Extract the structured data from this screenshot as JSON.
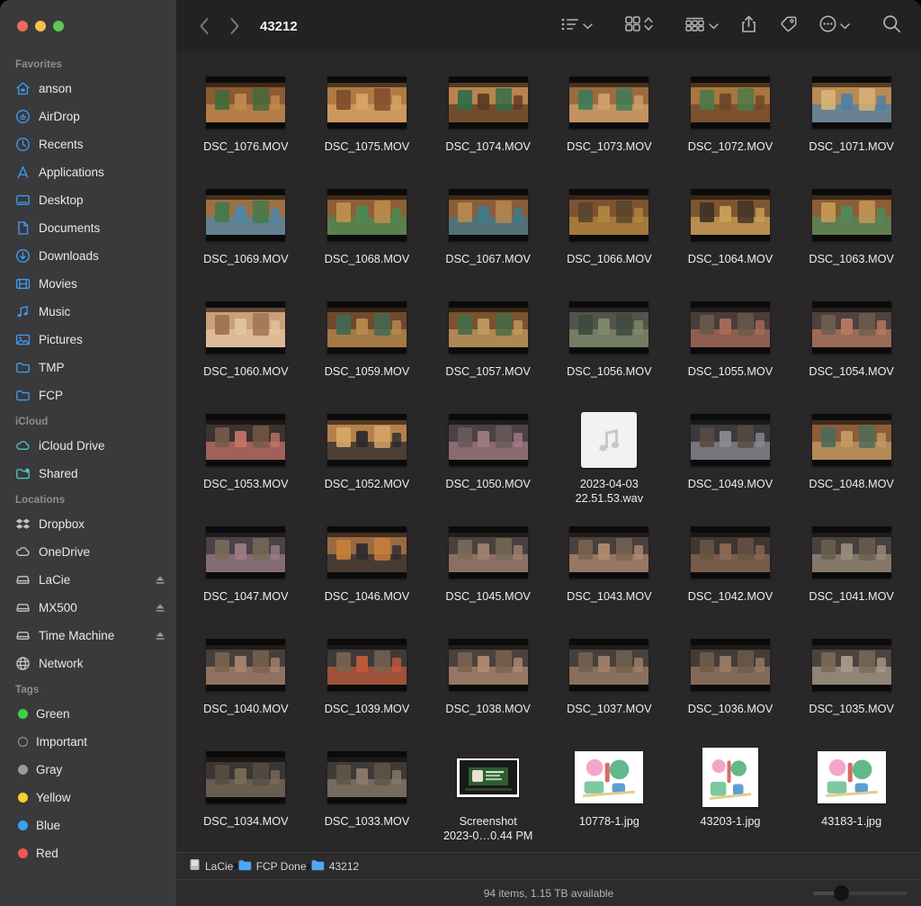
{
  "window": {
    "title": "43212",
    "traffic_lights": [
      {
        "name": "close",
        "color": "#ed6a5f"
      },
      {
        "name": "minimize",
        "color": "#f5bf4f"
      },
      {
        "name": "zoom",
        "color": "#61c555"
      }
    ]
  },
  "toolbar": {
    "back_icon": "chevron-left-icon",
    "forward_icon": "chevron-right-icon",
    "items": [
      {
        "name": "view-as-list",
        "icon": "list-view-icon",
        "has_chevron": true
      },
      {
        "name": "view-as-icons",
        "icon": "grid-view-icon",
        "has_stepper": true
      },
      {
        "name": "group-by",
        "icon": "group-by-icon",
        "has_chevron": true
      },
      {
        "name": "share",
        "icon": "share-icon",
        "has_chevron": false
      },
      {
        "name": "tags",
        "icon": "tag-icon",
        "has_chevron": false
      },
      {
        "name": "more-actions",
        "icon": "ellipsis-circle-icon",
        "has_chevron": true
      },
      {
        "name": "search",
        "icon": "search-icon",
        "has_chevron": false
      }
    ]
  },
  "sidebar": {
    "groups": [
      {
        "title": "Favorites",
        "items": [
          {
            "label": "anson",
            "icon": "home-icon",
            "tint": "blue"
          },
          {
            "label": "AirDrop",
            "icon": "airdrop-icon",
            "tint": "blue"
          },
          {
            "label": "Recents",
            "icon": "clock-icon",
            "tint": "blue"
          },
          {
            "label": "Applications",
            "icon": "applications-icon",
            "tint": "blue"
          },
          {
            "label": "Desktop",
            "icon": "desktop-icon",
            "tint": "blue"
          },
          {
            "label": "Documents",
            "icon": "document-icon",
            "tint": "blue"
          },
          {
            "label": "Downloads",
            "icon": "downloads-icon",
            "tint": "blue"
          },
          {
            "label": "Movies",
            "icon": "movies-icon",
            "tint": "blue"
          },
          {
            "label": "Music",
            "icon": "music-note-icon",
            "tint": "blue"
          },
          {
            "label": "Pictures",
            "icon": "pictures-icon",
            "tint": "blue"
          },
          {
            "label": "TMP",
            "icon": "folder-icon",
            "tint": "blue"
          },
          {
            "label": "FCP",
            "icon": "folder-icon",
            "tint": "blue"
          }
        ]
      },
      {
        "title": "iCloud",
        "items": [
          {
            "label": "iCloud Drive",
            "icon": "cloud-icon",
            "tint": "teal"
          },
          {
            "label": "Shared",
            "icon": "shared-folder-icon",
            "tint": "teal"
          }
        ]
      },
      {
        "title": "Locations",
        "items": [
          {
            "label": "Dropbox",
            "icon": "dropbox-icon",
            "tint": "gray",
            "eject": false
          },
          {
            "label": "OneDrive",
            "icon": "cloud-icon",
            "tint": "gray",
            "eject": false
          },
          {
            "label": "LaCie",
            "icon": "external-drive-icon",
            "tint": "gray",
            "eject": true
          },
          {
            "label": "MX500",
            "icon": "external-drive-icon",
            "tint": "gray",
            "eject": true
          },
          {
            "label": "Time Machine",
            "icon": "external-drive-icon",
            "tint": "gray",
            "eject": true
          },
          {
            "label": "Network",
            "icon": "network-globe-icon",
            "tint": "gray",
            "eject": false
          }
        ]
      },
      {
        "title": "Tags",
        "items": [
          {
            "label": "Green",
            "icon": "tag-dot-icon",
            "color": "#3fd040"
          },
          {
            "label": "Important",
            "icon": "tag-dot-icon",
            "color": "hollow"
          },
          {
            "label": "Gray",
            "icon": "tag-dot-icon",
            "color": "#9a9a9d"
          },
          {
            "label": "Yellow",
            "icon": "tag-dot-icon",
            "color": "#f6d232"
          },
          {
            "label": "Blue",
            "icon": "tag-dot-icon",
            "color": "#3aa0ef"
          },
          {
            "label": "Red",
            "icon": "tag-dot-icon",
            "color": "#ef5a4e"
          }
        ]
      }
    ]
  },
  "files": [
    {
      "name": "DSC_1076.MOV",
      "kind": "mov",
      "c1": "#8c5a33",
      "c2": "#c08a4e",
      "c3": "#3f6b3a"
    },
    {
      "name": "DSC_1075.MOV",
      "kind": "mov",
      "c1": "#b07a45",
      "c2": "#d7a366",
      "c3": "#7b4a2a"
    },
    {
      "name": "DSC_1074.MOV",
      "kind": "mov",
      "c1": "#b8844d",
      "c2": "#5c3a22",
      "c3": "#2f6b4a"
    },
    {
      "name": "DSC_1073.MOV",
      "kind": "mov",
      "c1": "#9a6c3f",
      "c2": "#cfa06a",
      "c3": "#3b7a5a"
    },
    {
      "name": "DSC_1072.MOV",
      "kind": "mov",
      "c1": "#a8763f",
      "c2": "#6d4628",
      "c3": "#4a7a4a"
    },
    {
      "name": "DSC_1071.MOV",
      "kind": "mov",
      "c1": "#b98b52",
      "c2": "#4d7fa8",
      "c3": "#d9b47a"
    },
    {
      "name": "DSC_1069.MOV",
      "kind": "mov",
      "c1": "#9e6f41",
      "c2": "#4e87a8",
      "c3": "#3f7a4a"
    },
    {
      "name": "DSC_1068.MOV",
      "kind": "mov",
      "c1": "#8d5f36",
      "c2": "#4a8a55",
      "c3": "#c2914f"
    },
    {
      "name": "DSC_1067.MOV",
      "kind": "mov",
      "c1": "#8a5d38",
      "c2": "#3d7a8d",
      "c3": "#b98a4f"
    },
    {
      "name": "DSC_1066.MOV",
      "kind": "mov",
      "c1": "#7e5230",
      "c2": "#b0873f",
      "c3": "#55452c"
    },
    {
      "name": "DSC_1064.MOV",
      "kind": "mov",
      "c1": "#7d5531",
      "c2": "#caa058",
      "c3": "#3f3026"
    },
    {
      "name": "DSC_1063.MOV",
      "kind": "mov",
      "c1": "#8b5e35",
      "c2": "#4f8a5a",
      "c3": "#c89a5a"
    },
    {
      "name": "DSC_1060.MOV",
      "kind": "mov",
      "c1": "#caa07a",
      "c2": "#e3c3a0",
      "c3": "#9a7050"
    },
    {
      "name": "DSC_1059.MOV",
      "kind": "mov",
      "c1": "#6e4a2c",
      "c2": "#b8894c",
      "c3": "#3f6a55"
    },
    {
      "name": "DSC_1057.MOV",
      "kind": "mov",
      "c1": "#7a5230",
      "c2": "#c09a5e",
      "c3": "#456b4a"
    },
    {
      "name": "DSC_1056.MOV",
      "kind": "mov",
      "c1": "#55524e",
      "c2": "#7d8a6a",
      "c3": "#3c4a3c"
    },
    {
      "name": "DSC_1055.MOV",
      "kind": "mov",
      "c1": "#4a3c3a",
      "c2": "#a86a5a",
      "c3": "#6a5a4a"
    },
    {
      "name": "DSC_1054.MOV",
      "kind": "mov",
      "c1": "#4f413d",
      "c2": "#b57a62",
      "c3": "#6f5f4e"
    },
    {
      "name": "DSC_1053.MOV",
      "kind": "mov",
      "c1": "#3b332f",
      "c2": "#c4726a",
      "c3": "#7a5a4a"
    },
    {
      "name": "DSC_1052.MOV",
      "kind": "mov",
      "c1": "#b5804a",
      "c2": "#2c2a2c",
      "c3": "#d8a868"
    },
    {
      "name": "DSC_1050.MOV",
      "kind": "mov",
      "c1": "#4a4246",
      "c2": "#a07a82",
      "c3": "#6a5a5a"
    },
    {
      "name": "2023-04-03\n22.51.53.wav",
      "kind": "wav"
    },
    {
      "name": "DSC_1049.MOV",
      "kind": "mov",
      "c1": "#3a3a3e",
      "c2": "#8a8a90",
      "c3": "#5a4a42"
    },
    {
      "name": "DSC_1048.MOV",
      "kind": "mov",
      "c1": "#8a5e38",
      "c2": "#c49a62",
      "c3": "#4a6a5a"
    },
    {
      "name": "DSC_1047.MOV",
      "kind": "mov",
      "c1": "#4a4246",
      "c2": "#9a7a84",
      "c3": "#7a6a5a"
    },
    {
      "name": "DSC_1046.MOV",
      "kind": "mov",
      "c1": "#9a6a42",
      "c2": "#2e2c2e",
      "c3": "#c8813c"
    },
    {
      "name": "DSC_1045.MOV",
      "kind": "mov",
      "c1": "#49413f",
      "c2": "#a08070",
      "c3": "#7a6a58"
    },
    {
      "name": "DSC_1043.MOV",
      "kind": "mov",
      "c1": "#4a403c",
      "c2": "#b08a70",
      "c3": "#7a6450"
    },
    {
      "name": "DSC_1042.MOV",
      "kind": "mov",
      "c1": "#3e3632",
      "c2": "#8a6a52",
      "c3": "#6a5442"
    },
    {
      "name": "DSC_1041.MOV",
      "kind": "mov",
      "c1": "#45413f",
      "c2": "#9a8a7a",
      "c3": "#6a5e4e"
    },
    {
      "name": "DSC_1040.MOV",
      "kind": "mov",
      "c1": "#473f3b",
      "c2": "#a8836e",
      "c3": "#7a6450"
    },
    {
      "name": "DSC_1039.MOV",
      "kind": "mov",
      "c1": "#3f3a38",
      "c2": "#c05a3a",
      "c3": "#7a6450"
    },
    {
      "name": "DSC_1038.MOV",
      "kind": "mov",
      "c1": "#4a423e",
      "c2": "#b08a70",
      "c3": "#7a6450"
    },
    {
      "name": "DSC_1037.MOV",
      "kind": "mov",
      "c1": "#46403c",
      "c2": "#a07f68",
      "c3": "#76614f"
    },
    {
      "name": "DSC_1036.MOV",
      "kind": "mov",
      "c1": "#423c38",
      "c2": "#9a7a62",
      "c3": "#705c4a"
    },
    {
      "name": "DSC_1035.MOV",
      "kind": "mov",
      "c1": "#4a4440",
      "c2": "#a89a8a",
      "c3": "#7a6a58"
    },
    {
      "name": "DSC_1034.MOV",
      "kind": "mov",
      "c1": "#3a3634",
      "c2": "#7a6a5a",
      "c3": "#5a4e42"
    },
    {
      "name": "DSC_1033.MOV",
      "kind": "mov",
      "c1": "#3e3a38",
      "c2": "#8a7a6a",
      "c3": "#62564a"
    },
    {
      "name": "Screenshot\n2023-0…0.44 PM",
      "kind": "screenshot"
    },
    {
      "name": "10778-1.jpg",
      "kind": "jpg",
      "orient": "landscape"
    },
    {
      "name": "43203-1.jpg",
      "kind": "jpg",
      "orient": "portrait"
    },
    {
      "name": "43183-1.jpg",
      "kind": "jpg",
      "orient": "landscape"
    }
  ],
  "pathbar": {
    "crumbs": [
      {
        "label": "LaCie",
        "icon": "drive-icon"
      },
      {
        "label": "FCP Done",
        "icon": "folder-icon"
      },
      {
        "label": "43212",
        "icon": "folder-icon"
      }
    ],
    "separator": "›"
  },
  "statusbar": {
    "text": "94 items, 1.15 TB available",
    "zoom_slider_value": 30
  }
}
